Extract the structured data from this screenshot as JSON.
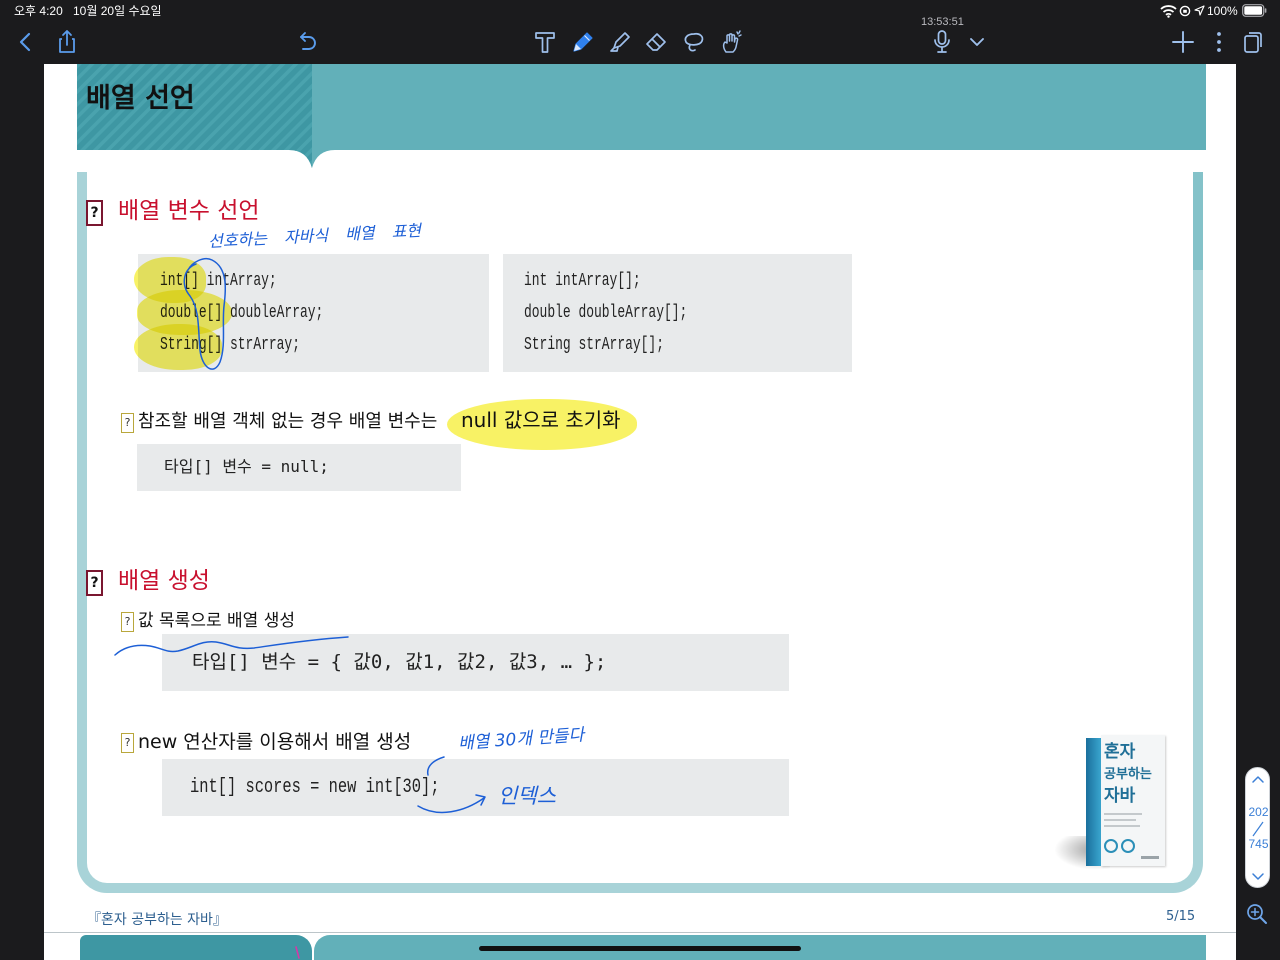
{
  "status_bar": {
    "time": "오후 4:20",
    "date": "10월 20일 수요일",
    "battery_level": "100%",
    "icons": [
      "wifi-icon",
      "rotation-lock-icon",
      "location-icon",
      "battery-icon"
    ]
  },
  "toolbar": {
    "recording_timer": "13:53:51",
    "left_icons": [
      "back-icon",
      "share-icon",
      "undo-icon"
    ],
    "tools": [
      "text-tool-icon",
      "pen-tool-icon",
      "highlighter-tool-icon",
      "eraser-tool-icon",
      "lasso-tool-icon",
      "laser-pointer-tool-icon"
    ],
    "selected_tool": "pen-tool-icon",
    "right_icons": [
      "microphone-icon",
      "chevron-down-icon",
      "add-icon",
      "more-icon",
      "pages-icon"
    ]
  },
  "page": {
    "header_title": "배열 선언",
    "marker": "?",
    "section_1": {
      "title": "배열 변수 선언",
      "annotation": "선호하는 자바식 배열 표현",
      "code_preferred": [
        "int[] intArray;",
        "double[] doubleArray;",
        "String[] strArray;"
      ],
      "code_alternative": [
        "int intArray[];",
        "double doubleArray[];",
        "String strArray[];"
      ],
      "null_note": "참조할 배열 객체 없는 경우 배열 변수는",
      "null_note_highlight": "null 값으로 초기화",
      "null_code": "타입[] 변수 = null;"
    },
    "section_2": {
      "title": "배열 생성",
      "list_note": "값 목록으로 배열 생성",
      "list_code": "타입[] 변수 = { 값0, 값1, 값2, 값3, … };",
      "new_note": "new 연산자를 이용해서 배열 생성",
      "new_annotation": "배열 30개 만들다",
      "new_code": "int[] scores = new int[30];",
      "index_annotation": "인덱스"
    },
    "book_cover": {
      "line_1": "혼자",
      "line_2": "공부하는",
      "line_3": "자바"
    },
    "footer_title": "『혼자 공부하는 자바』",
    "page_number": "5/15"
  },
  "page_navigator": {
    "current_page": "202",
    "total_pages": "745",
    "icons": [
      "chevron-up-icon",
      "chevron-down-icon",
      "zoom-icon"
    ]
  },
  "colors": {
    "accent_red": "#c8102e",
    "header_teal": "#62b0b9",
    "header_teal_dark": "#3e97a3",
    "frame_teal": "#a8d3d8",
    "ink_blue": "#1d5fd6",
    "highlighter_yellow": "#f6ee3a",
    "selected_tool_blue": "#2f80ed",
    "code_background": "#e8eaeb"
  }
}
